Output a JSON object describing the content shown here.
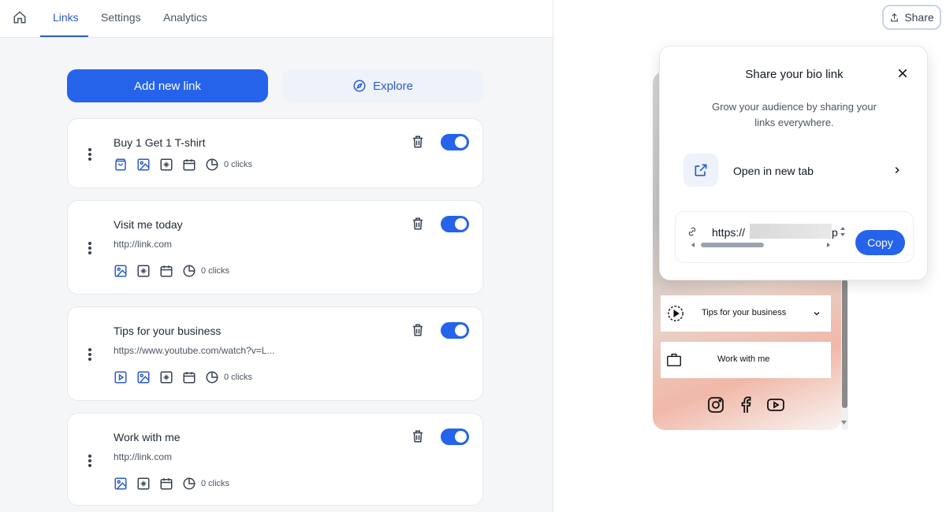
{
  "nav": {
    "tabs": [
      "Links",
      "Settings",
      "Analytics"
    ],
    "share_label": "Share"
  },
  "actions": {
    "add_label": "Add new link",
    "explore_label": "Explore"
  },
  "links": [
    {
      "title": "Buy 1 Get 1 T-shirt",
      "url": "",
      "clicks": "0 clicks",
      "enabled": true,
      "icons": [
        "shop-bag-icon",
        "image-icon",
        "sparkle-icon",
        "calendar-icon",
        "analytics-pie-icon"
      ]
    },
    {
      "title": "Visit me today",
      "url": "http://link.com",
      "clicks": "0 clicks",
      "enabled": true,
      "icons": [
        "image-icon",
        "sparkle-icon",
        "calendar-icon",
        "analytics-pie-icon"
      ]
    },
    {
      "title": "Tips for your business",
      "url": "https://www.youtube.com/watch?v=L...",
      "clicks": "0 clicks",
      "enabled": true,
      "icons": [
        "video-icon",
        "image-icon",
        "sparkle-icon",
        "calendar-icon",
        "analytics-pie-icon"
      ]
    },
    {
      "title": "Work with me",
      "url": "http://link.com",
      "clicks": "0 clicks",
      "enabled": true,
      "icons": [
        "image-icon",
        "sparkle-icon",
        "calendar-icon",
        "analytics-pie-icon"
      ]
    }
  ],
  "preview": {
    "rows": [
      "Tips for your business",
      "Work with me"
    ],
    "social": [
      "instagram-icon",
      "facebook-icon",
      "youtube-icon"
    ]
  },
  "share_popover": {
    "title": "Share your bio link",
    "description": "Grow your audience by sharing your links everywhere.",
    "open_label": "Open in new tab",
    "url_prefix": "https://",
    "url_suffix": "p",
    "copy_label": "Copy"
  },
  "colors": {
    "primary": "#2563eb",
    "accent_text": "#2b5cc8"
  }
}
